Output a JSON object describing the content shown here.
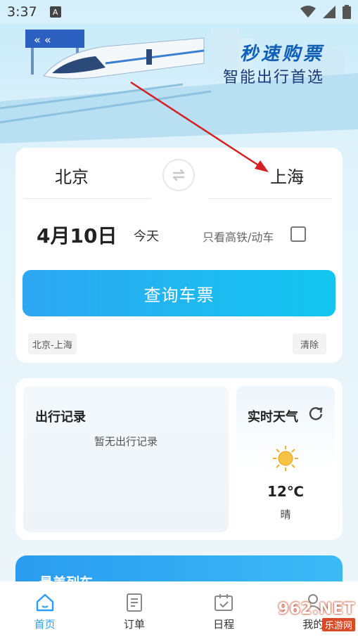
{
  "status_bar": {
    "time": "3:37",
    "notification_letter": "A"
  },
  "banner": {
    "title": "秒速购票",
    "subtitle": "智能出行首选"
  },
  "search": {
    "from_city": "北京",
    "to_city": "上海",
    "date": "4月10日",
    "day_label": "今天",
    "high_speed_only_label": "只看高铁/动车",
    "high_speed_only_checked": false,
    "query_button": "查询车票",
    "history": [
      "北京-上海"
    ],
    "clear_label": "清除"
  },
  "records": {
    "title": "出行记录",
    "empty_text": "暂无出行记录"
  },
  "weather": {
    "title": "实时天气",
    "temperature": "12℃",
    "condition": "晴"
  },
  "popular": {
    "title": "最美列车"
  },
  "nav": {
    "items": [
      {
        "label": "首页",
        "icon": "home-icon",
        "active": true
      },
      {
        "label": "订单",
        "icon": "order-icon",
        "active": false
      },
      {
        "label": "日程",
        "icon": "calendar-icon",
        "active": false
      },
      {
        "label": "我的",
        "icon": "user-icon",
        "active": false
      }
    ]
  },
  "watermark": {
    "top": "962.NET",
    "bottom": "乐游网"
  },
  "colors": {
    "accent": "#2a9df4",
    "button_start": "#2ea7f2",
    "button_end": "#12c6ef",
    "annotation_arrow": "#d42020"
  }
}
